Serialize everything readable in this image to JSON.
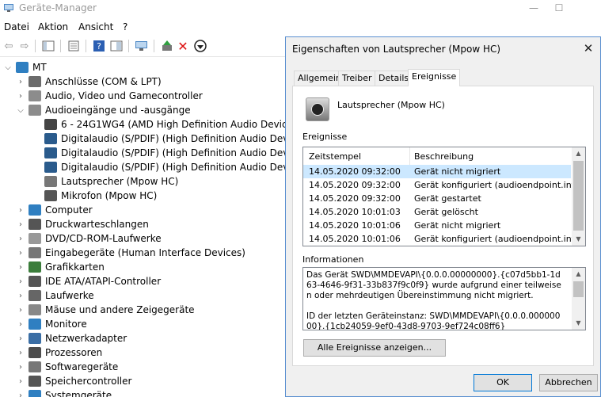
{
  "main": {
    "title": "Geräte-Manager",
    "window_controls": {
      "minimize": "—",
      "maximize": "☐"
    },
    "menu": [
      "Datei",
      "Aktion",
      "Ansicht",
      "?"
    ],
    "tree": {
      "root": "MT",
      "items": [
        {
          "label": "Anschlüsse (COM & LPT)",
          "icon": "port-icon",
          "color": "#6b6b6b"
        },
        {
          "label": "Audio, Video und Gamecontroller",
          "icon": "speaker-icon",
          "color": "#8c8c8c"
        },
        {
          "label": "Audioeingänge und -ausgänge",
          "icon": "speaker-icon",
          "color": "#8c8c8c",
          "expanded": true
        },
        {
          "label": "6 - 24G1WG4 (AMD High Definition Audio Device)",
          "icon": "monitor-icon",
          "color": "#444444",
          "child": true
        },
        {
          "label": "Digitalaudio (S/PDIF) (High Definition Audio Device)",
          "icon": "audio-port-icon",
          "color": "#2a5b8c",
          "child": true
        },
        {
          "label": "Digitalaudio (S/PDIF) (High Definition Audio Device)",
          "icon": "audio-port-icon",
          "color": "#2a5b8c",
          "child": true
        },
        {
          "label": "Digitalaudio (S/PDIF) (High Definition Audio Device)",
          "icon": "audio-port-icon",
          "color": "#2a5b8c",
          "child": true
        },
        {
          "label": "Lautsprecher (Mpow HC)",
          "icon": "speaker-icon",
          "color": "#777777",
          "child": true
        },
        {
          "label": "Mikrofon (Mpow HC)",
          "icon": "microphone-icon",
          "color": "#555555",
          "child": true
        },
        {
          "label": "Computer",
          "icon": "computer-icon",
          "color": "#2f7fc1"
        },
        {
          "label": "Druckwarteschlangen",
          "icon": "printer-icon",
          "color": "#555555"
        },
        {
          "label": "DVD/CD-ROM-Laufwerke",
          "icon": "disc-icon",
          "color": "#999999"
        },
        {
          "label": "Eingabegeräte (Human Interface Devices)",
          "icon": "hid-icon",
          "color": "#777777"
        },
        {
          "label": "Grafikkarten",
          "icon": "display-adapter-icon",
          "color": "#3b7d3b"
        },
        {
          "label": "IDE ATA/ATAPI-Controller",
          "icon": "controller-icon",
          "color": "#555555"
        },
        {
          "label": "Laufwerke",
          "icon": "drive-icon",
          "color": "#666666"
        },
        {
          "label": "Mäuse und andere Zeigegeräte",
          "icon": "mouse-icon",
          "color": "#888888"
        },
        {
          "label": "Monitore",
          "icon": "monitor-icon",
          "color": "#2f7fc1"
        },
        {
          "label": "Netzwerkadapter",
          "icon": "network-icon",
          "color": "#3b6ea5"
        },
        {
          "label": "Prozessoren",
          "icon": "processor-icon",
          "color": "#4d4d4d"
        },
        {
          "label": "Softwaregeräte",
          "icon": "software-icon",
          "color": "#777777"
        },
        {
          "label": "Speichercontroller",
          "icon": "storage-icon",
          "color": "#555555"
        },
        {
          "label": "Systemgeräte",
          "icon": "system-icon",
          "color": "#2f7fc1"
        }
      ]
    }
  },
  "dialog": {
    "title": "Eigenschaften von Lautsprecher (Mpow HC)",
    "close_glyph": "✕",
    "tabs": [
      "Allgemein",
      "Treiber",
      "Details",
      "Ereignisse"
    ],
    "active_tab": "Ereignisse",
    "device_name": "Lautsprecher (Mpow HC)",
    "events_label": "Ereignisse",
    "columns": [
      "Zeitstempel",
      "Beschreibung"
    ],
    "events": [
      {
        "time": "14.05.2020 09:32:00",
        "desc": "Gerät nicht migriert",
        "selected": true
      },
      {
        "time": "14.05.2020 09:32:00",
        "desc": "Gerät konfiguriert (audioendpoint.inf)"
      },
      {
        "time": "14.05.2020 09:32:00",
        "desc": "Gerät gestartet"
      },
      {
        "time": "14.05.2020 10:01:03",
        "desc": "Gerät gelöscht"
      },
      {
        "time": "14.05.2020 10:01:06",
        "desc": "Gerät nicht migriert"
      },
      {
        "time": "14.05.2020 10:01:06",
        "desc": "Gerät konfiguriert (audioendpoint.inf)"
      }
    ],
    "info_label": "Informationen",
    "info_text": "Das Gerät SWD\\MMDEVAPI\\{0.0.0.00000000}.{c07d5bb1-1d63-4646-9f31-33b837f9c0f9} wurde aufgrund einer teilweisen oder mehrdeutigen Übereinstimmung nicht migriert.\n\nID der letzten Geräteinstanz: SWD\\MMDEVAPI\\{0.0.0.00000000}.{1cb24059-9ef0-43d8-9703-9ef724c08ff6}",
    "show_all_button": "Alle Ereignisse anzeigen...",
    "ok_button": "OK",
    "cancel_button": "Abbrechen"
  }
}
